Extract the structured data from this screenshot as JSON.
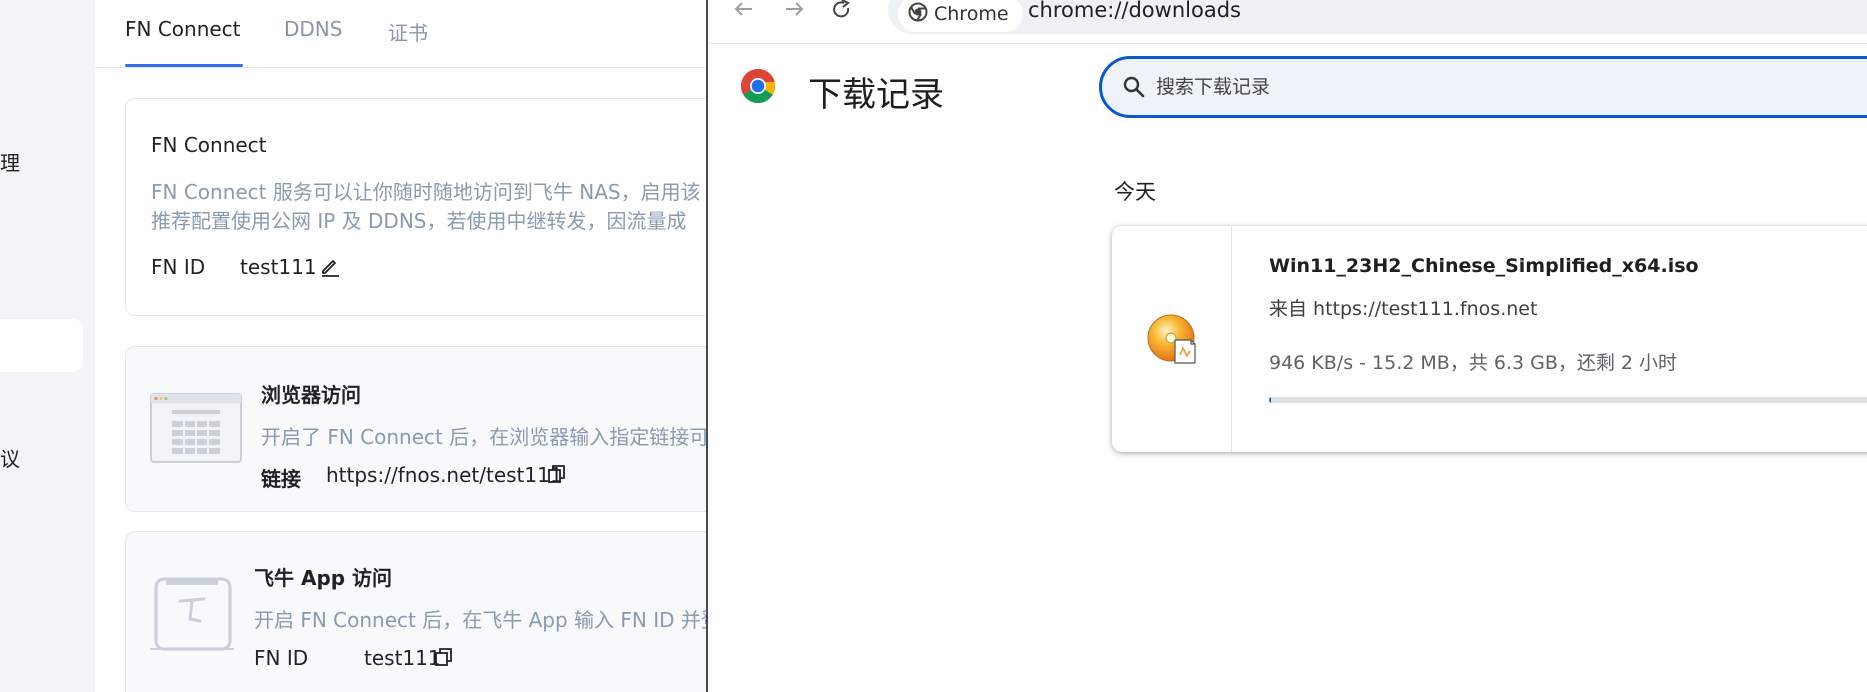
{
  "left_app": {
    "sidebar": {
      "fragments": [
        "理",
        "议"
      ]
    },
    "tabs": [
      "FN Connect",
      "DDNS",
      "证书"
    ],
    "fn_connect_card": {
      "title": "FN Connect",
      "desc_line1": "FN Connect 服务可以让你随时随地访问到飞牛 NAS，启用该",
      "desc_line2": "推荐配置使用公网 IP 及 DDNS，若使用中继转发，因流量成",
      "id_label": "FN ID",
      "id_value": "test111"
    },
    "browser_card": {
      "title": "浏览器访问",
      "desc": "开启了 FN Connect 后，在浏览器输入指定链接可",
      "link_label": "链接",
      "link_value": "https://fnos.net/test111"
    },
    "app_card": {
      "title": "飞牛 App 访问",
      "desc": "开启 FN Connect 后，在飞牛 App 输入 FN ID 并登",
      "id_label": "FN ID",
      "id_value": "test111"
    }
  },
  "chrome": {
    "chip_label": "Chrome",
    "url": "chrome://downloads",
    "page_title": "下载记录",
    "search_placeholder": "搜索下载记录",
    "date_group": "今天",
    "download": {
      "file_name": "Win11_23H2_Chinese_Simplified_x64.iso",
      "source": "来自 https://test111.fnos.net",
      "status": "946 KB/s - 15.2 MB，共 6.3 GB，还剩 2 小时",
      "progress_fraction": 0.0024
    }
  },
  "colors": {
    "accent_blue": "#2f6fed",
    "chrome_blue": "#0b57d0",
    "muted_text": "#8a9ab0"
  }
}
